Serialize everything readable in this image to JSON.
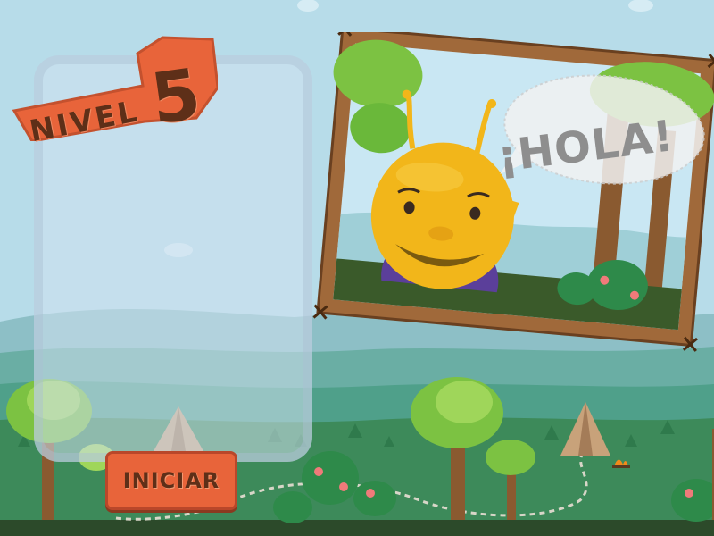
{
  "level": {
    "word": "NIVEL",
    "number": "5"
  },
  "start_button": {
    "label": "INICIAR"
  },
  "speech_bubble": {
    "text": "¡HOLA!"
  },
  "colors": {
    "sky": "#b7dce9",
    "hills_far": "#8dbfc6",
    "hills_mid": "#4fa08a",
    "grass": "#3d8a5a",
    "badge_orange": "#e8643a",
    "badge_text": "#5e2f18",
    "character_yellow": "#f2b61a",
    "character_shirt": "#5b3f9a",
    "frame_wood": "#a0693a"
  },
  "icons": [
    "tent-icon",
    "campfire-icon",
    "palm-tree-icon",
    "bush-icon",
    "cloud-icon"
  ]
}
